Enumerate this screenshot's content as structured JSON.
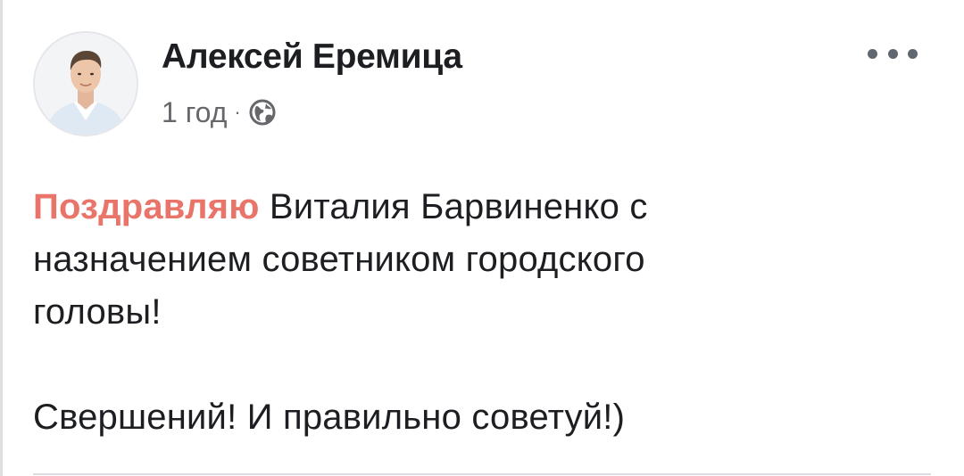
{
  "author": {
    "name": "Алексей Еремица"
  },
  "meta": {
    "time": "1 год",
    "separator": "·",
    "privacy_icon": "globe-icon"
  },
  "menu": {
    "icon": "more-horizontal-icon"
  },
  "post": {
    "highlight_word": "Поздравляю",
    "line1_rest": " Виталия Барвиненко с",
    "line2": "назначением советником городского",
    "line3": "головы!",
    "line4": "Свершений! И правильно советуй!)"
  },
  "colors": {
    "highlight": "#e9756a",
    "text": "#1c1e21",
    "secondary": "#65676b"
  }
}
